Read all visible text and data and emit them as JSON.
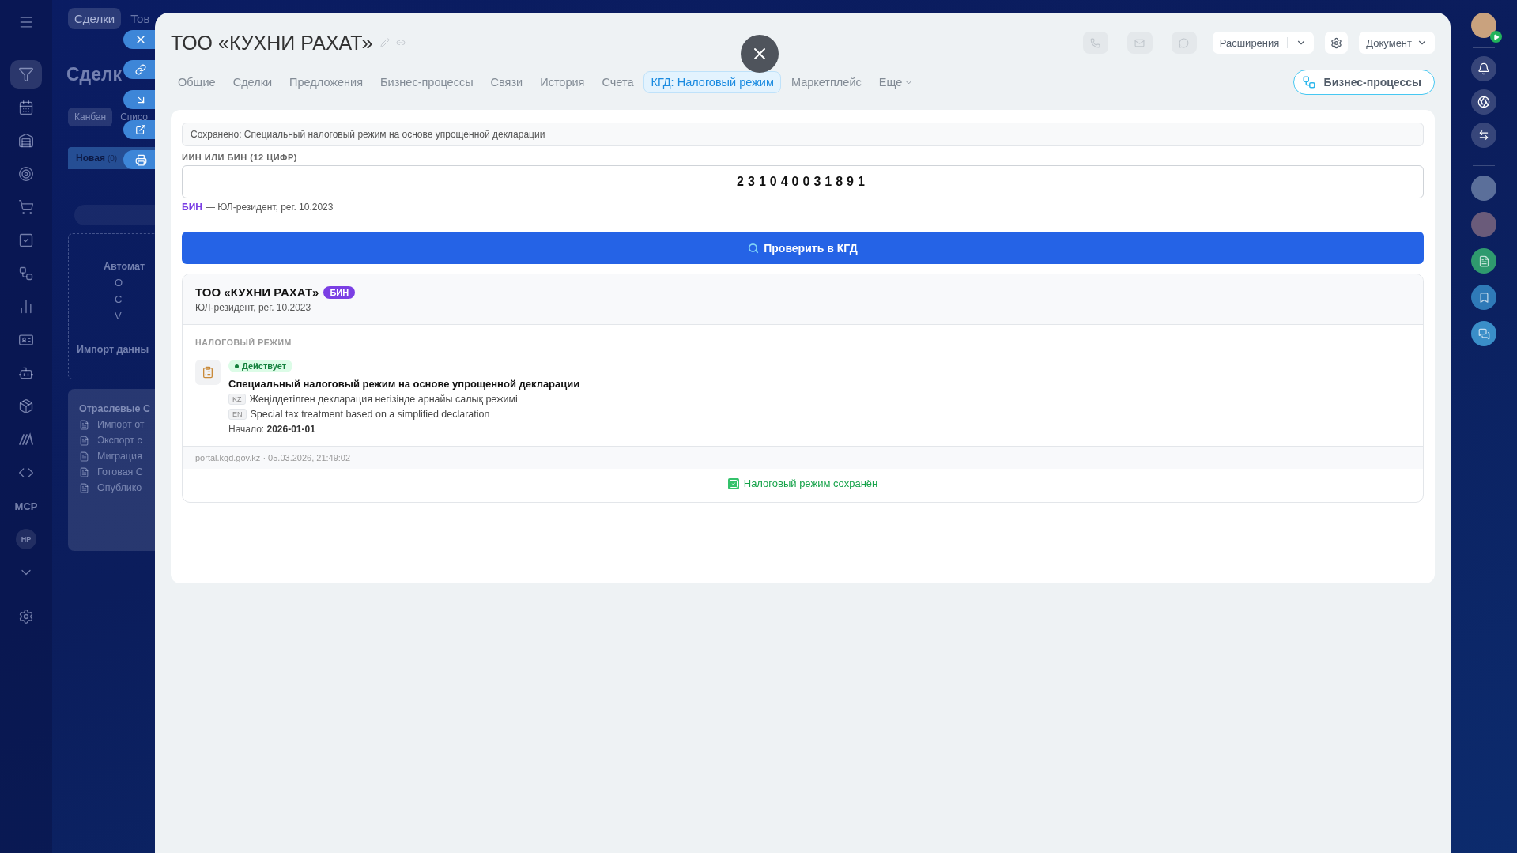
{
  "left_nav": {
    "items": [
      {
        "kind": "icon",
        "selected": false
      },
      {
        "kind": "icon",
        "selected": true
      },
      {
        "kind": "icon",
        "selected": false
      },
      {
        "kind": "icon",
        "selected": false
      },
      {
        "kind": "icon",
        "selected": false
      },
      {
        "kind": "icon",
        "selected": false
      },
      {
        "kind": "icon",
        "selected": false
      },
      {
        "kind": "icon",
        "selected": false
      },
      {
        "kind": "icon",
        "selected": false
      },
      {
        "kind": "icon",
        "selected": false
      },
      {
        "kind": "icon",
        "selected": false
      },
      {
        "kind": "icon",
        "selected": false
      },
      {
        "kind": "icon",
        "selected": false
      },
      {
        "kind": "icon",
        "selected": false
      },
      {
        "kind": "text",
        "label": "MCP",
        "selected": false
      },
      {
        "kind": "avatar",
        "label": "HP",
        "selected": false
      },
      {
        "kind": "icon",
        "selected": false
      },
      {
        "kind": "icon",
        "selected": false
      }
    ]
  },
  "background_page": {
    "top_tabs": [
      {
        "label": "Сделки",
        "selected": true
      },
      {
        "label": "Тов",
        "selected": false
      }
    ],
    "heading": "Сделк",
    "view_tabs": [
      {
        "label": "Канбан",
        "selected": true
      },
      {
        "label": "Списо",
        "selected": false
      }
    ],
    "column": {
      "title": "Новая",
      "count": "(0)"
    },
    "automation": {
      "title": "Автомат",
      "rows": [
        "О",
        "С",
        "V"
      ],
      "import": "Импорт данны"
    },
    "industry": {
      "title": "Отраслевые С",
      "items": [
        "Импорт от",
        "Экспорт с",
        "Миграция",
        "Готовая С",
        "Опублико"
      ]
    }
  },
  "panel": {
    "title": "ТОО «КУХНИ РАХАТ»",
    "toolbar": {
      "extensions": "Расширения",
      "document": "Документ"
    },
    "tabs": [
      {
        "label": "Общие",
        "kind": "tab",
        "selected": false
      },
      {
        "label": "Сделки",
        "kind": "tab",
        "selected": false
      },
      {
        "label": "Предложения",
        "kind": "tab",
        "selected": false
      },
      {
        "label": "Бизнес-процессы",
        "kind": "tab",
        "selected": false
      },
      {
        "label": "Связи",
        "kind": "tab",
        "selected": false
      },
      {
        "label": "История",
        "kind": "tab",
        "selected": false
      },
      {
        "label": "Счета",
        "kind": "tab",
        "selected": false
      },
      {
        "label": "КГД: Налоговый режим",
        "kind": "tab",
        "selected": true
      },
      {
        "label": "Маркетплейс",
        "kind": "tab",
        "selected": false
      },
      {
        "label": "Еще",
        "kind": "more",
        "selected": false
      }
    ],
    "bp_button": "Бизнес-процессы",
    "content": {
      "saved_note": "Сохранено: Специальный налоговый режим на основе упрощенной декларации",
      "field": {
        "label": "ИИН ИЛИ БИН (12 ЦИФР)",
        "value": "231040031891"
      },
      "hint": {
        "tag": "БИН",
        "text": "— ЮЛ-резидент, рег. 10.2023"
      },
      "check_button": "Проверить в КГД",
      "result": {
        "name": "ТОО «КУХНИ РАХАТ»",
        "badge": "БИН",
        "subtitle": "ЮЛ-резидент, рег. 10.2023",
        "section_label": "НАЛОГОВЫЙ РЕЖИМ",
        "regime": {
          "status": "Действует",
          "active": true,
          "title": "Специальный налоговый режим на основе упрощенной декларации",
          "translations": [
            {
              "lang": "KZ",
              "text": "Жеңілдетілген декларация негізінде арнайы салық режимі"
            },
            {
              "lang": "EN",
              "text": "Special tax treatment based on a simplified declaration"
            }
          ],
          "start": "Начало: **2026-01-01**"
        },
        "source": "portal.kgd.gov.kz · 05.03.2026, 21:49:02",
        "saved": "Налоговый режим сохранён"
      }
    }
  }
}
